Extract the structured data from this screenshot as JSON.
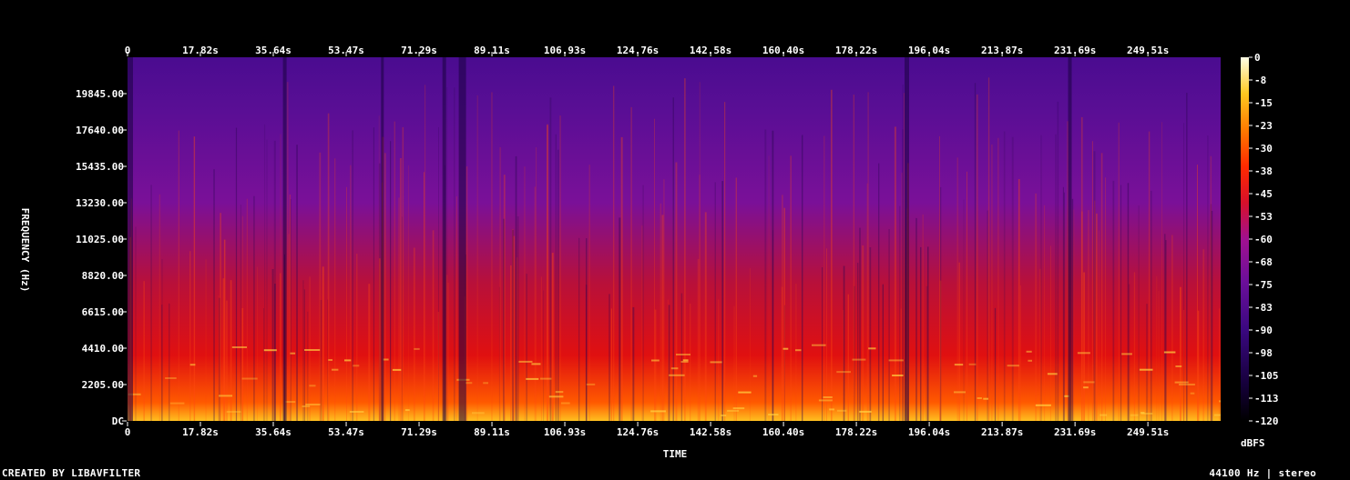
{
  "chart_data": {
    "type": "heatmap",
    "title": "",
    "xlabel": "TIME",
    "ylabel": "FREQUENCY (Hz)",
    "x_ticks": [
      "0",
      "17.82s",
      "35.64s",
      "53.47s",
      "71.29s",
      "89.11s",
      "106.93s",
      "124.76s",
      "142.58s",
      "160.40s",
      "178.22s",
      "196.04s",
      "213.87s",
      "231.69s",
      "249.51s"
    ],
    "x_tick_values": [
      0,
      17.82,
      35.64,
      53.47,
      71.29,
      89.11,
      106.93,
      124.76,
      142.58,
      160.4,
      178.22,
      196.04,
      213.87,
      231.69,
      249.51
    ],
    "xlim": [
      0,
      267.3
    ],
    "y_ticks": [
      "DC",
      "2205.00",
      "4410.00",
      "6615.00",
      "8820.00",
      "11025.00",
      "13230.00",
      "15435.00",
      "17640.00",
      "19845.00"
    ],
    "y_tick_values": [
      0,
      2205,
      4410,
      6615,
      8820,
      11025,
      13230,
      15435,
      17640,
      19845
    ],
    "ylim": [
      0,
      22050
    ],
    "colorbar": {
      "label": "dBFS",
      "ticks": [
        "0",
        "-8",
        "-15",
        "-23",
        "-30",
        "-38",
        "-45",
        "-53",
        "-60",
        "-68",
        "-75",
        "-83",
        "-90",
        "-98",
        "-105",
        "-113",
        "-120"
      ],
      "range": [
        -120,
        0
      ]
    },
    "colormap": [
      "#000000",
      "#1a0050",
      "#4b0a8a",
      "#7a1298",
      "#b0108a",
      "#e0102a",
      "#ff3000",
      "#ff8a00",
      "#ffd020",
      "#ffffd0"
    ]
  },
  "footer": {
    "left": "CREATED BY LIBAVFILTER",
    "right": "44100 Hz | stereo"
  }
}
